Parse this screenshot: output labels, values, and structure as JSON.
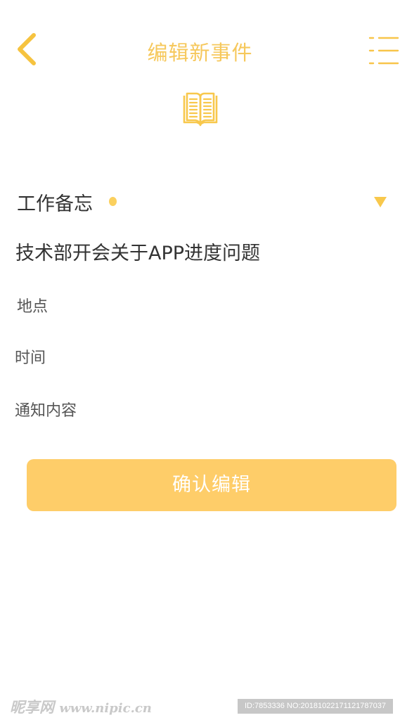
{
  "header": {
    "title": "编辑新事件",
    "back_icon": "chevron-left-icon",
    "menu_icon": "list-menu-icon"
  },
  "hero": {
    "icon": "open-book-icon"
  },
  "form": {
    "category": {
      "label": "工作备忘",
      "dot_color": "#fbd05e",
      "dropdown_icon": "triangle-down-icon"
    },
    "event_title": "技术部开会关于APP进度问题",
    "location_placeholder": "地点",
    "time_placeholder": "时间",
    "notice_placeholder": "通知内容"
  },
  "actions": {
    "confirm_label": "确认编辑"
  },
  "watermark": {
    "logo": "昵享网",
    "site": "www.nipic.cn",
    "id_text": "ID:7853336 NO:20181022171121787037"
  },
  "colors": {
    "accent": "#f6c85c",
    "button": "#fecd69",
    "text": "#333333"
  }
}
